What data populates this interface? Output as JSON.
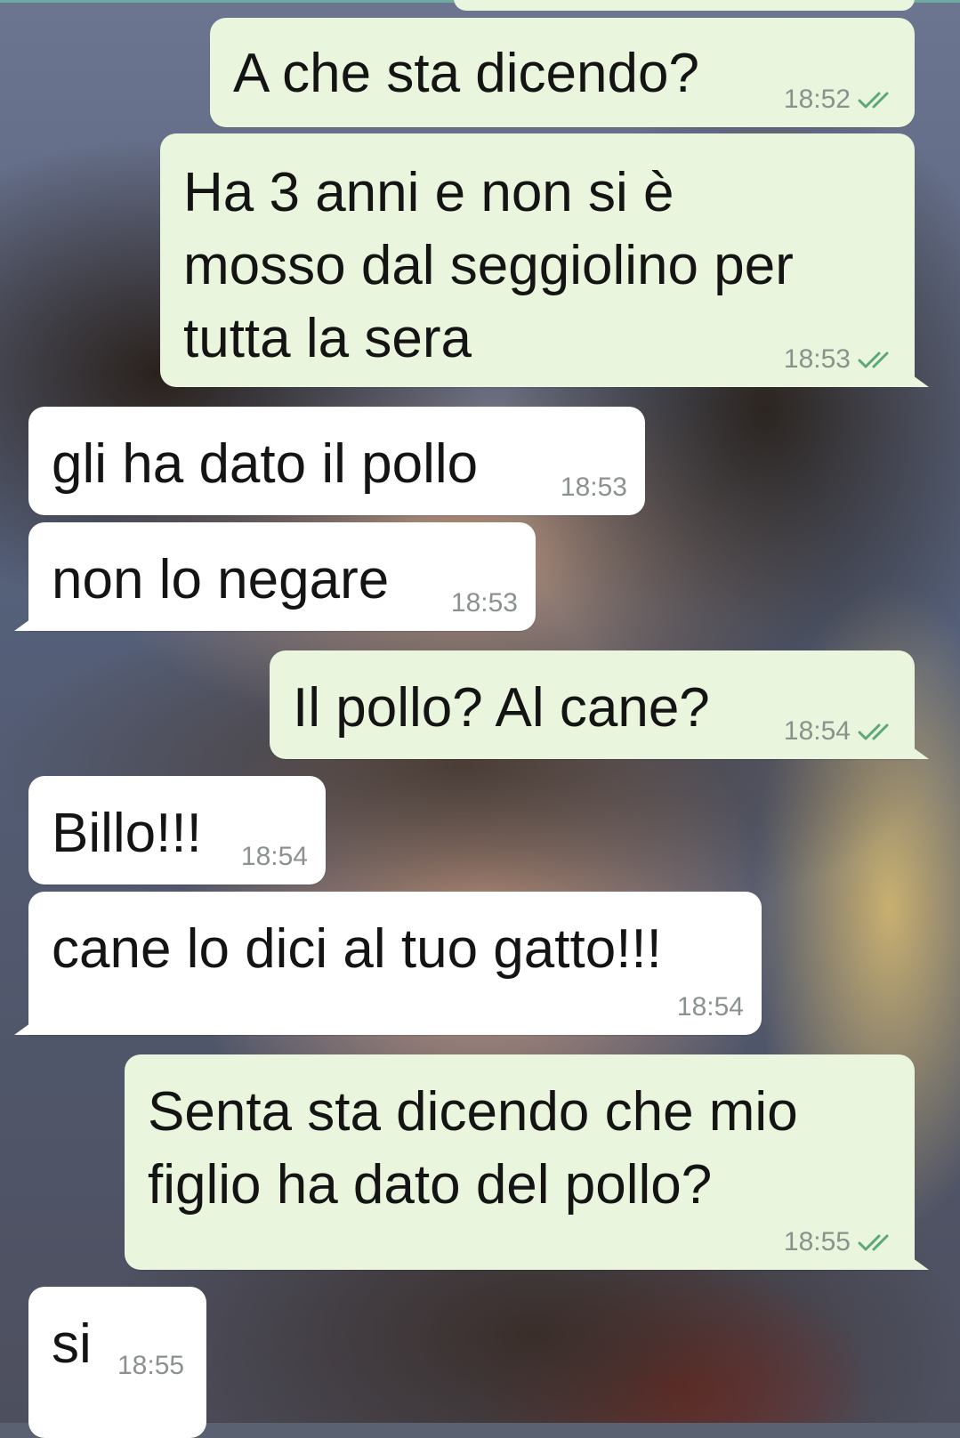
{
  "colors": {
    "outgoing_bubble": "#e9f5dc",
    "incoming_bubble": "#ffffff",
    "read_ticks": "#5aa87a",
    "timestamp": "#8b928d"
  },
  "messages": [
    {
      "id": "m1",
      "direction": "outgoing",
      "text": "A che sta dicendo?",
      "time": "18:52",
      "status": "read",
      "status_icon": "double-check-icon"
    },
    {
      "id": "m2",
      "direction": "outgoing",
      "text": "Ha 3 anni e non si è\nmosso dal seggiolino per\ntutta la sera",
      "time": "18:53",
      "status": "read",
      "status_icon": "double-check-icon"
    },
    {
      "id": "m3",
      "direction": "incoming",
      "text": "gli ha dato il pollo",
      "time": "18:53"
    },
    {
      "id": "m4",
      "direction": "incoming",
      "text": "non lo negare",
      "time": "18:53"
    },
    {
      "id": "m5",
      "direction": "outgoing",
      "text": "Il pollo? Al cane?",
      "time": "18:54",
      "status": "read",
      "status_icon": "double-check-icon"
    },
    {
      "id": "m6",
      "direction": "incoming",
      "text": "Billo!!!",
      "time": "18:54"
    },
    {
      "id": "m7",
      "direction": "incoming",
      "text": "cane lo dici al tuo gatto!!!",
      "time": "18:54"
    },
    {
      "id": "m8",
      "direction": "outgoing",
      "text": "Senta sta dicendo che mio\nfiglio ha dato del pollo?",
      "time": "18:55",
      "status": "read",
      "status_icon": "double-check-icon"
    },
    {
      "id": "m9",
      "direction": "incoming",
      "text": "si",
      "time": "18:55"
    }
  ]
}
